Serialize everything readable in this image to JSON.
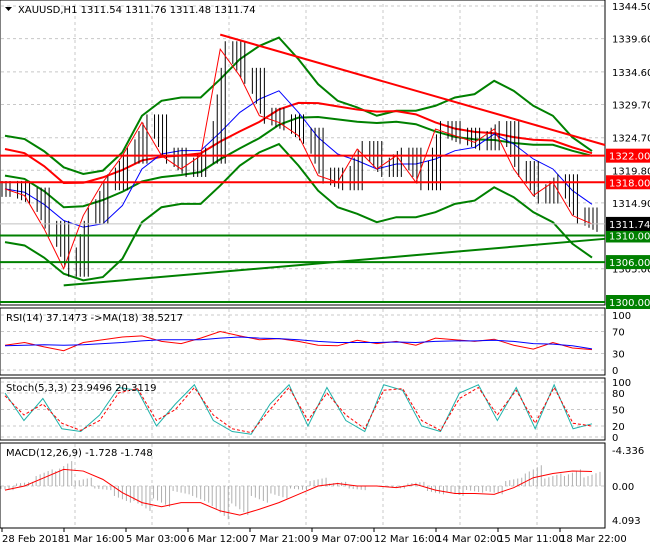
{
  "header": {
    "symbol": "XAUUSD,H1",
    "open": "1311.54",
    "high": "1311.76",
    "low": "1311.48",
    "close": "1311.74"
  },
  "colors": {
    "up": "#000000",
    "down": "#000000",
    "resistance": "#ff0000",
    "support": "#008000",
    "rsi": "#ff0000",
    "rsi_ma": "#0000ff",
    "stoch_main": "#20b2aa",
    "stoch_signal": "#ff0000",
    "macd_hist": "#c0c0c0",
    "macd_signal": "#ff0000"
  },
  "chart_data": [
    {
      "type": "line",
      "title": "XAUUSD,H1",
      "ylim": [
        1300,
        1344.5
      ],
      "y_ticks": [
        "1344.50",
        "1339.60",
        "1334.60",
        "1329.70",
        "1324.70",
        "1319.80",
        "1314.90",
        "1305.00"
      ],
      "x_ticks": [
        "28 Feb 2018",
        "1 Mar 16:00",
        "5 Mar 03:00",
        "6 Mar 12:00",
        "7 Mar 21:00",
        "9 Mar 07:00",
        "12 Mar 16:00",
        "14 Mar 02:00",
        "15 Mar 11:00",
        "18 Mar 22:00"
      ],
      "close": [
        1317,
        1316,
        1311,
        1305,
        1313,
        1318,
        1322,
        1327,
        1322,
        1320,
        1322,
        1338,
        1334,
        1328,
        1327,
        1325,
        1319,
        1318,
        1323,
        1320,
        1322,
        1318,
        1326,
        1325,
        1324,
        1326,
        1320,
        1316,
        1318,
        1313,
        1311.74
      ],
      "current_price": "1311.74",
      "levels": [
        {
          "price": "1322.00",
          "color": "red"
        },
        {
          "price": "1318.00",
          "color": "red"
        },
        {
          "price": "1310.00",
          "color": "green"
        },
        {
          "price": "1306.00",
          "color": "green"
        },
        {
          "price": "1300.00",
          "color": "green"
        }
      ],
      "trendlines": [
        {
          "name": "resistance",
          "from_price": 1340.2,
          "to_price": 1323.6,
          "from_index": 11,
          "to_index": 30
        },
        {
          "name": "support",
          "from_price": 1302.5,
          "to_price": 1309.5,
          "from_index": 3,
          "to_index": 30
        }
      ]
    },
    {
      "type": "line",
      "title": "RSI(14) 37.1473  ->MA(18) 38.5217",
      "ylim": [
        0,
        100
      ],
      "y_ticks": [
        "100",
        "70",
        "30",
        "0"
      ],
      "rsi": [
        45,
        50,
        42,
        35,
        50,
        55,
        60,
        62,
        52,
        48,
        58,
        70,
        62,
        55,
        57,
        52,
        45,
        44,
        54,
        48,
        52,
        45,
        58,
        55,
        52,
        56,
        45,
        38,
        50,
        40,
        37
      ],
      "ma": [
        44,
        45,
        46,
        45,
        46,
        48,
        50,
        53,
        55,
        55,
        55,
        58,
        60,
        58,
        57,
        55,
        52,
        50,
        50,
        50,
        51,
        50,
        52,
        53,
        53,
        54,
        52,
        48,
        47,
        44,
        38.5
      ]
    },
    {
      "type": "line",
      "title": "Stoch(5,3,3) 23.9496 20.3119",
      "ylim": [
        0,
        100
      ],
      "y_ticks": [
        "100",
        "80",
        "50",
        "20",
        "0"
      ],
      "main": [
        80,
        30,
        70,
        15,
        10,
        40,
        90,
        85,
        20,
        60,
        95,
        30,
        10,
        5,
        60,
        95,
        20,
        90,
        30,
        10,
        95,
        85,
        20,
        10,
        80,
        95,
        30,
        90,
        15,
        95,
        15,
        24
      ],
      "signal": [
        75,
        40,
        60,
        25,
        12,
        30,
        80,
        88,
        30,
        50,
        90,
        40,
        15,
        8,
        50,
        90,
        30,
        80,
        40,
        15,
        85,
        88,
        30,
        12,
        70,
        90,
        40,
        85,
        25,
        90,
        25,
        20
      ]
    },
    {
      "type": "bar",
      "title": "MACD(12,26,9) -1.728 -1.748",
      "ylim": [
        -4.336,
        4.093
      ],
      "y_ticks": [
        "4.093",
        "0.00",
        "-4.336"
      ],
      "hist": [
        0.5,
        -0.5,
        -2,
        -3,
        -1,
        0.5,
        2,
        3,
        2.5,
        1,
        2,
        4,
        3.5,
        2,
        1.5,
        0.5,
        -1,
        -0.5,
        0.5,
        0,
        0.3,
        -0.5,
        1,
        1.2,
        0.8,
        1,
        -1,
        -2.5,
        -1.5,
        -2,
        -1.7
      ],
      "signal": [
        0.5,
        0,
        -1,
        -2,
        -1.8,
        -0.8,
        0.8,
        2,
        2.5,
        2,
        2,
        3,
        3.5,
        2.8,
        2,
        1,
        0,
        -0.3,
        0,
        0,
        0.2,
        -0.2,
        0.5,
        0.9,
        0.9,
        1,
        0.2,
        -1,
        -1.5,
        -1.8,
        -1.75
      ]
    }
  ]
}
